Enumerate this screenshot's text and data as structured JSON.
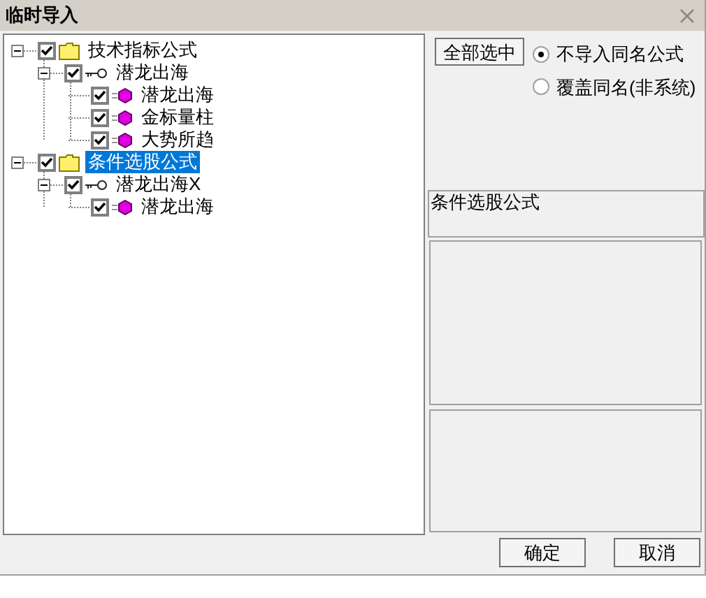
{
  "window": {
    "title": "临时导入"
  },
  "tree": [
    {
      "label": "技术指标公式",
      "kind": "folder",
      "checked": true,
      "expanded": true,
      "selected": false,
      "children": [
        {
          "label": "潜龙出海",
          "kind": "key",
          "checked": true,
          "expanded": true,
          "selected": false,
          "children": [
            {
              "label": "潜龙出海",
              "kind": "formula",
              "checked": true,
              "selected": false
            },
            {
              "label": "金标量柱",
              "kind": "formula",
              "checked": true,
              "selected": false
            },
            {
              "label": "大势所趋",
              "kind": "formula",
              "checked": true,
              "selected": false
            }
          ]
        }
      ]
    },
    {
      "label": "条件选股公式",
      "kind": "folder",
      "checked": true,
      "expanded": true,
      "selected": true,
      "children": [
        {
          "label": "潜龙出海X",
          "kind": "key",
          "checked": true,
          "expanded": true,
          "selected": false,
          "children": [
            {
              "label": "潜龙出海",
              "kind": "formula",
              "checked": true,
              "selected": false
            }
          ]
        }
      ]
    }
  ],
  "select_all_button": "全部选中",
  "import_options": [
    {
      "label": "不导入同名公式",
      "selected": true
    },
    {
      "label": "覆盖同名(非系统)",
      "selected": false
    }
  ],
  "description_field": {
    "value": "条件选股公式"
  },
  "buttons": [
    "确定",
    "取消"
  ]
}
